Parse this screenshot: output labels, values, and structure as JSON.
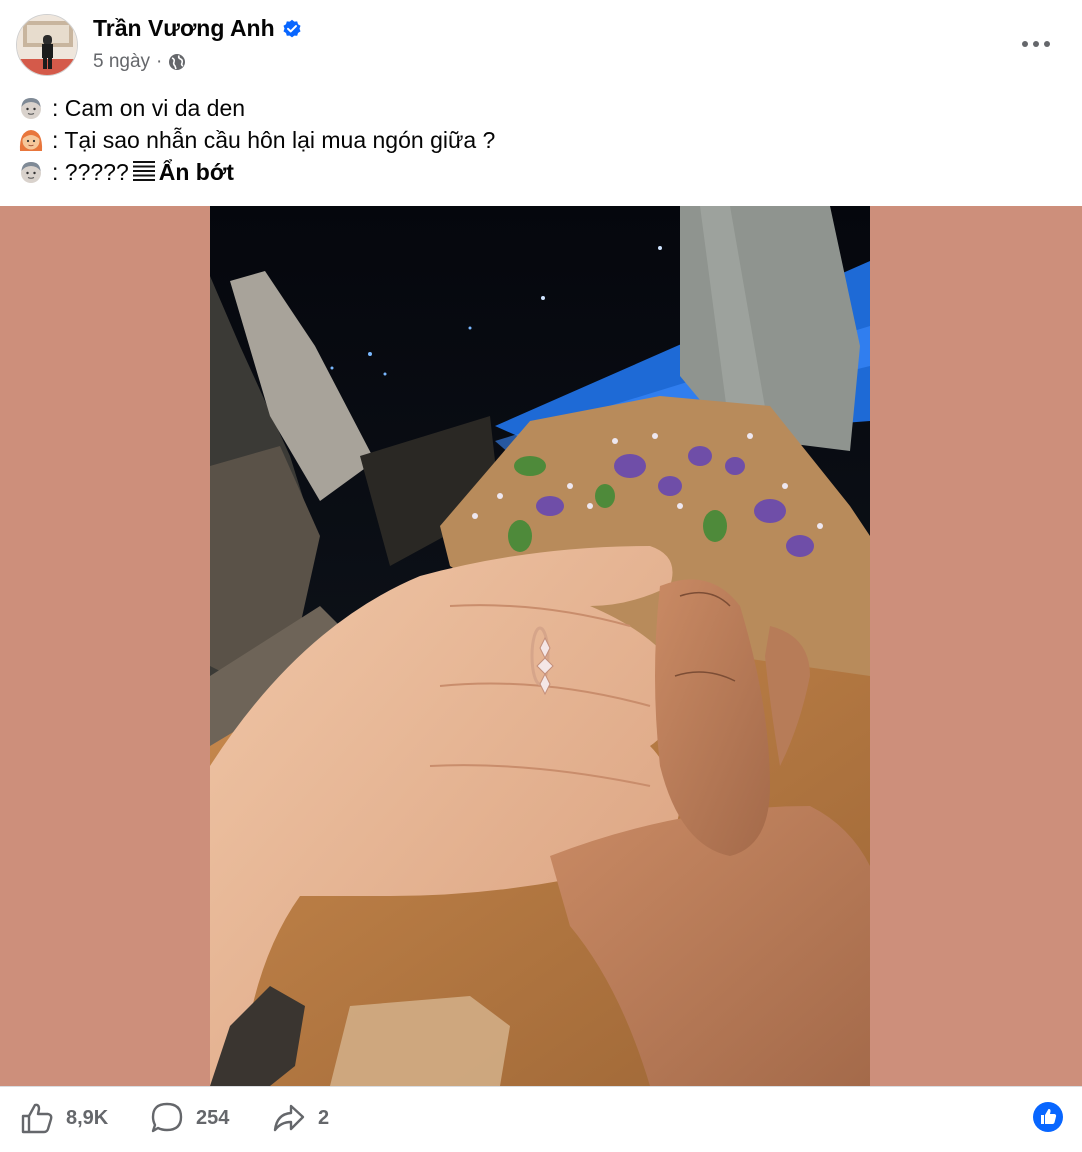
{
  "post": {
    "author": "Trần Vương Anh",
    "time": "5 ngày",
    "separator": "·",
    "privacy_icon": "globe-icon",
    "verified_icon": "verified-badge-icon",
    "menu_icon": "more-horizontal-icon",
    "caption": [
      {
        "emoji": "man-emoji",
        "text": ": Cam on vi da den"
      },
      {
        "emoji": "woman-emoji",
        "text": ": Tại sao nhẫn cầu hôn lại mua ngón giữa ?"
      },
      {
        "emoji": "man-emoji",
        "text": ": ????? "
      }
    ],
    "see_less": "Ẩn bớt",
    "photo_description_icon": "photo"
  },
  "actions": {
    "like_count": "8,9K",
    "comment_count": "254",
    "share_count": "2"
  },
  "colors": {
    "accent": "#0866ff",
    "media_background": "#cd8f7b",
    "muted_text": "#65676b"
  }
}
